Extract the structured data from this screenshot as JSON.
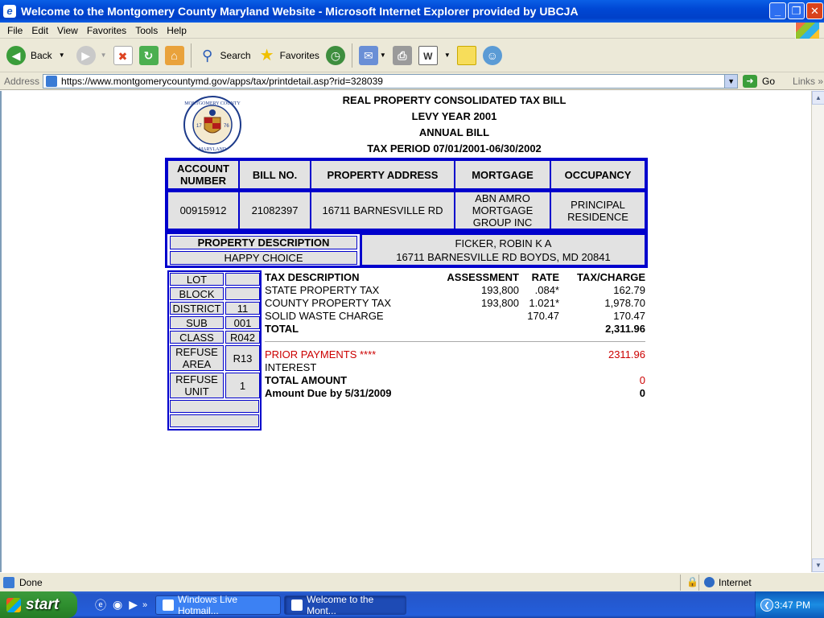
{
  "window": {
    "title": "Welcome to the Montgomery County Maryland Website - Microsoft Internet Explorer provided by UBCJA"
  },
  "menu": [
    "File",
    "Edit",
    "View",
    "Favorites",
    "Tools",
    "Help"
  ],
  "toolbar": {
    "back": "Back",
    "search": "Search",
    "favorites": "Favorites"
  },
  "address": {
    "label": "Address",
    "url": "https://www.montgomerycountymd.gov/apps/tax/printdetail.asp?rid=328039",
    "go": "Go",
    "links": "Links"
  },
  "status": {
    "text": "Done",
    "zone": "Internet"
  },
  "taskbar": {
    "start": "start",
    "tasks": [
      "Windows Live Hotmail...",
      "Welcome to the Mont..."
    ],
    "clock": "3:47 PM"
  },
  "bill": {
    "seal": {
      "top": "MONTGOMERY COUNTY",
      "bottom": "MARYLAND",
      "year_left": "17",
      "year_right": "76"
    },
    "title": "REAL PROPERTY CONSOLIDATED TAX BILL",
    "levy_year": "LEVY YEAR  2001",
    "bill_type": "ANNUAL BILL",
    "tax_period": "TAX PERIOD  07/01/2001-06/30/2002",
    "headers": {
      "account": "ACCOUNT NUMBER",
      "bill_no": "BILL NO.",
      "address": "PROPERTY ADDRESS",
      "mortgage": "MORTGAGE",
      "occupancy": "OCCUPANCY"
    },
    "values": {
      "account": "00915912",
      "bill_no": "21082397",
      "address": "16711 BARNESVILLE RD",
      "mortgage": "ABN AMRO MORTGAGE GROUP INC",
      "occupancy": "PRINCIPAL RESIDENCE"
    },
    "property_description_label": "PROPERTY DESCRIPTION",
    "property_description": "HAPPY CHOICE",
    "owner": "FICKER, ROBIN K A",
    "owner_address": "16711 BARNESVILLE RD BOYDS, MD 20841",
    "lot_table": [
      {
        "label": "LOT",
        "value": ""
      },
      {
        "label": "BLOCK",
        "value": ""
      },
      {
        "label": "DISTRICT",
        "value": "11"
      },
      {
        "label": "SUB",
        "value": "001"
      },
      {
        "label": "CLASS",
        "value": "R042"
      },
      {
        "label": "REFUSE AREA",
        "value": "R13"
      },
      {
        "label": "REFUSE UNIT",
        "value": "1"
      }
    ],
    "tax_headers": {
      "desc": "TAX DESCRIPTION",
      "assessment": "ASSESSMENT",
      "rate": "RATE",
      "charge": "TAX/CHARGE"
    },
    "tax_rows": [
      {
        "desc": "STATE PROPERTY TAX",
        "assessment": "193,800",
        "rate": ".084*",
        "charge": "162.79"
      },
      {
        "desc": "COUNTY PROPERTY TAX",
        "assessment": "193,800",
        "rate": "1.021*",
        "charge": "1,978.70"
      },
      {
        "desc": "SOLID WASTE CHARGE",
        "assessment": "",
        "rate": "170.47",
        "charge": "170.47"
      }
    ],
    "total_label": "TOTAL",
    "total": "2,311.96",
    "prior_payments_label": "PRIOR PAYMENTS ****",
    "prior_payments": "2311.96",
    "interest_label": "INTEREST",
    "total_amount_label": "TOTAL AMOUNT",
    "total_amount": "0",
    "amount_due_label": "Amount Due by 5/31/2009",
    "amount_due": "0",
    "red": "#cc0000",
    "border": "#0000cc"
  }
}
